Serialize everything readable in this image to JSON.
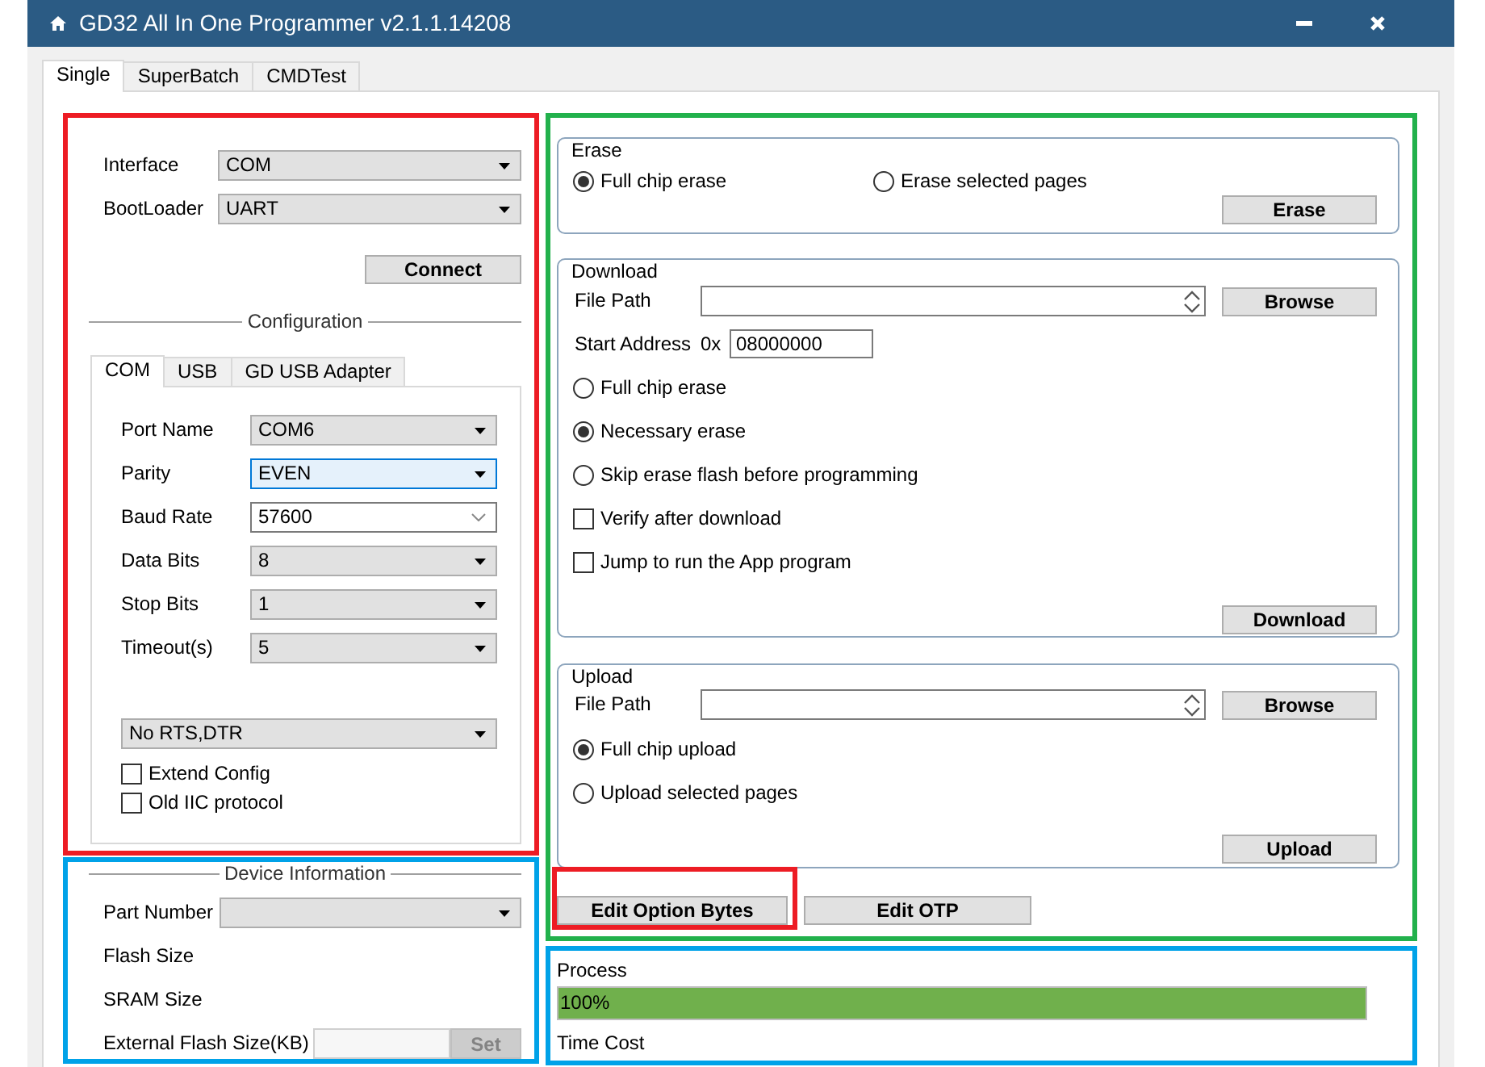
{
  "window": {
    "title": "GD32 All In One Programmer v2.1.1.14208"
  },
  "tabs": [
    {
      "label": "Single",
      "selected": true
    },
    {
      "label": "SuperBatch",
      "selected": false
    },
    {
      "label": "CMDTest",
      "selected": false
    }
  ],
  "connection": {
    "color": "#ed1c24",
    "fields": [
      {
        "label": "Interface",
        "value": "COM"
      },
      {
        "label": "BootLoader",
        "value": "UART"
      }
    ],
    "connect_button": "Connect",
    "configuration": {
      "title": "Configuration",
      "tabs": [
        {
          "label": "COM",
          "selected": true
        },
        {
          "label": "USB",
          "selected": false
        },
        {
          "label": "GD USB Adapter",
          "selected": false
        }
      ],
      "fields": [
        {
          "label": "Port Name",
          "value": "COM6",
          "kind": "dropdown",
          "focused": false
        },
        {
          "label": "Parity",
          "value": "EVEN",
          "kind": "dropdown",
          "focused": true
        },
        {
          "label": "Baud Rate",
          "value": "57600",
          "kind": "editable",
          "focused": false
        },
        {
          "label": "Data Bits",
          "value": "8",
          "kind": "dropdown",
          "focused": false
        },
        {
          "label": "Stop Bits",
          "value": "1",
          "kind": "dropdown",
          "focused": false
        },
        {
          "label": "Timeout(s)",
          "value": "5",
          "kind": "dropdown",
          "focused": false
        }
      ],
      "flow_control": "No RTS,DTR",
      "checkboxes": [
        {
          "label": "Extend Config",
          "checked": false
        },
        {
          "label": "Old IIC protocol",
          "checked": false
        }
      ]
    }
  },
  "device_information": {
    "color": "#00a2e8",
    "title": "Device Information",
    "fields": [
      {
        "kind": "dropdown",
        "label": "Part Number"
      },
      {
        "kind": "text",
        "label": "Flash Size"
      },
      {
        "kind": "text",
        "label": "SRAM Size"
      },
      {
        "kind": "input",
        "label": "External Flash Size(KB)",
        "button": "Set",
        "disabled": true
      }
    ]
  },
  "operations": {
    "color": "#22b14c",
    "erase": {
      "title": "Erase",
      "options": [
        {
          "kind": "radio",
          "label": "Full chip erase",
          "selected": true
        },
        {
          "kind": "radio",
          "label": "Erase selected pages",
          "selected": false
        }
      ],
      "button": "Erase"
    },
    "download": {
      "title": "Download",
      "file_path_label": "File Path",
      "browse_button": "Browse",
      "start_address_label": "Start Address",
      "address_prefix": "0x",
      "start_address": "08000000",
      "options": [
        {
          "kind": "radio",
          "label": "Full chip erase",
          "selected": false
        },
        {
          "kind": "radio",
          "label": "Necessary erase",
          "selected": true
        },
        {
          "kind": "radio",
          "label": "Skip erase flash before programming",
          "selected": false
        },
        {
          "kind": "checkbox",
          "label": "Verify after download",
          "checked": false
        },
        {
          "kind": "checkbox",
          "label": "Jump to run the App program",
          "checked": false
        }
      ],
      "button": "Download"
    },
    "upload": {
      "title": "Upload",
      "file_path_label": "File Path",
      "browse_button": "Browse",
      "options": [
        {
          "kind": "radio",
          "label": "Full chip upload",
          "selected": true
        },
        {
          "kind": "radio",
          "label": "Upload selected pages",
          "selected": false
        }
      ],
      "button": "Upload"
    },
    "buttons": [
      {
        "label": "Edit Option Bytes",
        "color": "#ed1c24"
      },
      {
        "label": "Edit OTP"
      }
    ]
  },
  "process": {
    "color": "#00a2e8",
    "label": "Process",
    "level": 1,
    "reading": "100%",
    "time_cost_label": "Time Cost"
  }
}
